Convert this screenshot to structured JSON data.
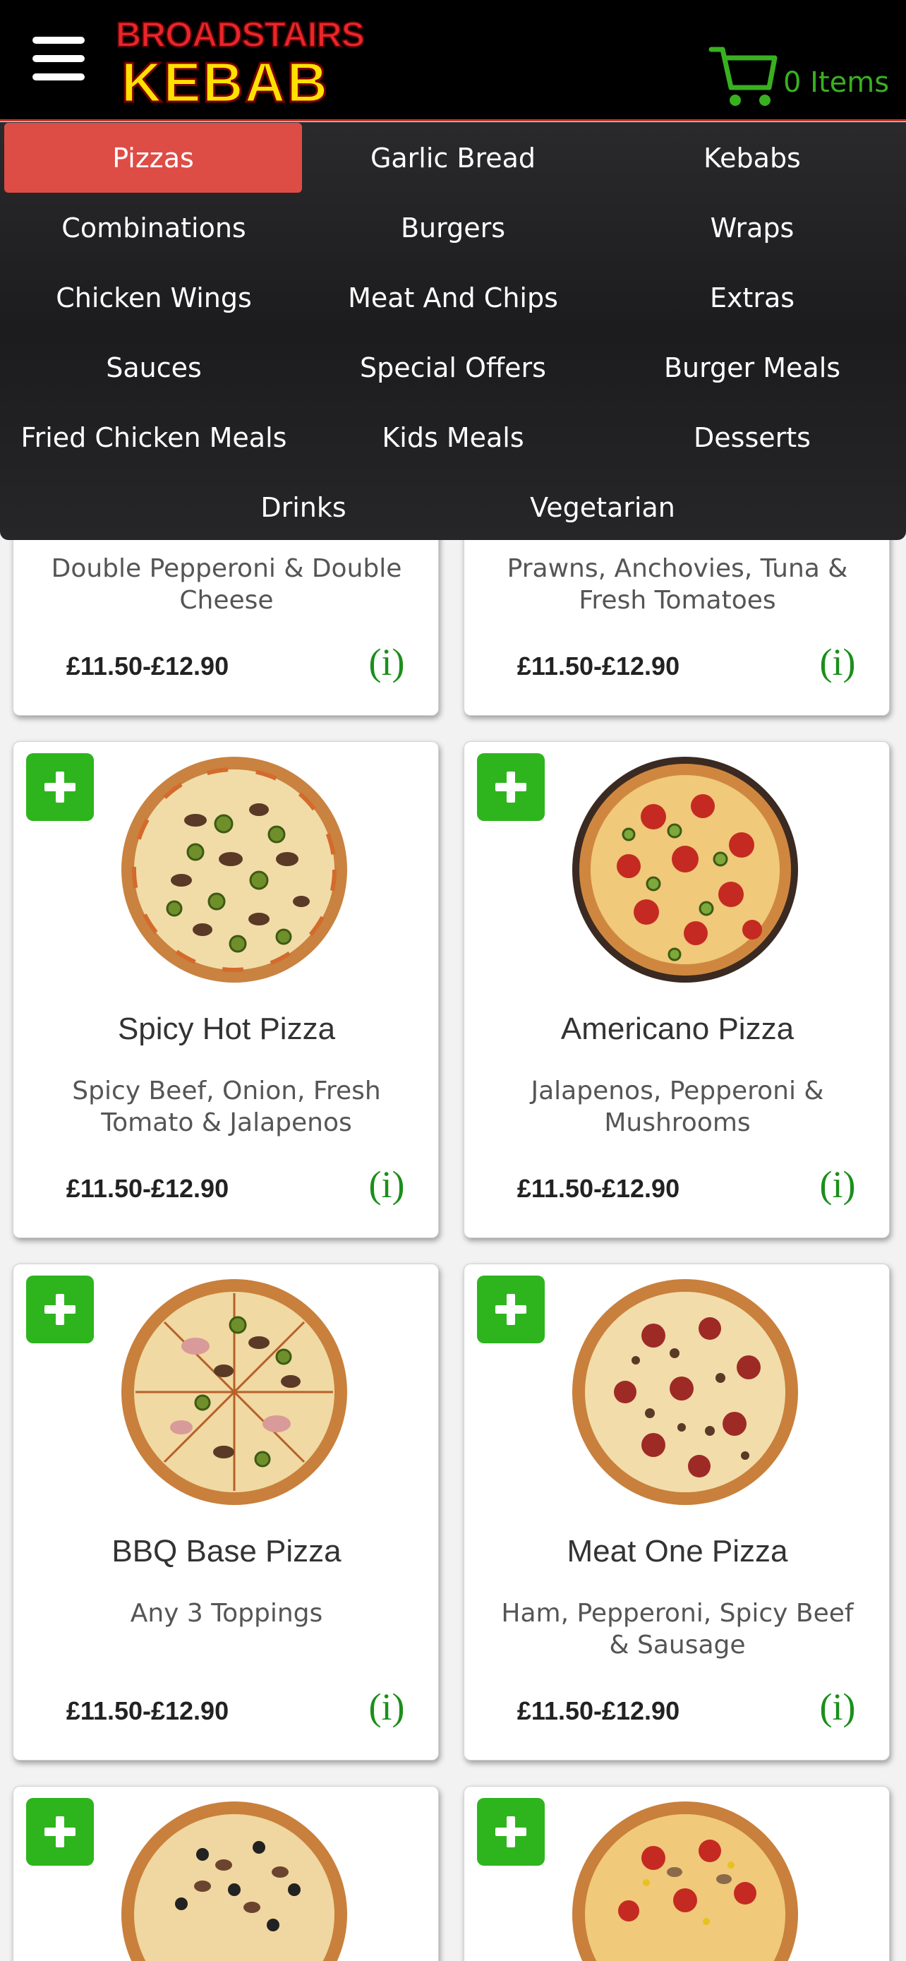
{
  "header": {
    "brand_top": "BROADSTAIRS",
    "brand_bottom": "KEBAB",
    "cart_label": "0 Items",
    "cart_icon": "shopping-cart-icon",
    "menu_icon": "hamburger-menu-icon"
  },
  "categories": [
    {
      "label": "Pizzas",
      "active": true
    },
    {
      "label": "Garlic Bread"
    },
    {
      "label": "Kebabs"
    },
    {
      "label": "Combinations"
    },
    {
      "label": "Burgers"
    },
    {
      "label": "Wraps"
    },
    {
      "label": "Chicken Wings"
    },
    {
      "label": "Meat And Chips"
    },
    {
      "label": "Extras"
    },
    {
      "label": "Sauces"
    },
    {
      "label": "Special Offers"
    },
    {
      "label": "Burger Meals"
    },
    {
      "label": "Fried Chicken Meals"
    },
    {
      "label": "Kids Meals"
    },
    {
      "label": "Desserts"
    },
    {
      "label": "Drinks"
    },
    {
      "label": "Vegetarian"
    }
  ],
  "products": [
    {
      "title": "",
      "desc": "Double Pepperoni & Double Cheese",
      "price": "£11.50-£12.90",
      "info": "(i)"
    },
    {
      "title": "",
      "desc": "Prawns, Anchovies, Tuna & Fresh Tomatoes",
      "price": "£11.50-£12.90",
      "info": "(i)"
    },
    {
      "title": "Spicy Hot Pizza",
      "desc": "Spicy Beef, Onion, Fresh Tomato & Jalapenos",
      "price": "£11.50-£12.90",
      "info": "(i)"
    },
    {
      "title": "Americano Pizza",
      "desc": "Jalapenos, Pepperoni & Mushrooms",
      "price": "£11.50-£12.90",
      "info": "(i)"
    },
    {
      "title": "BBQ Base Pizza",
      "desc": "Any 3 Toppings",
      "price": "£11.50-£12.90",
      "info": "(i)"
    },
    {
      "title": "Meat One Pizza",
      "desc": "Ham, Pepperoni, Spicy Beef & Sausage",
      "price": "£11.50-£12.90",
      "info": "(i)"
    },
    {
      "title": "",
      "desc": "",
      "price": "",
      "info": ""
    },
    {
      "title": "",
      "desc": "",
      "price": "",
      "info": ""
    }
  ],
  "colors": {
    "header_bg": "#000000",
    "active_category": "#de4c46",
    "add_button": "#2eb51e",
    "cart_green": "#39b020",
    "info_green": "#1c8f1c"
  }
}
